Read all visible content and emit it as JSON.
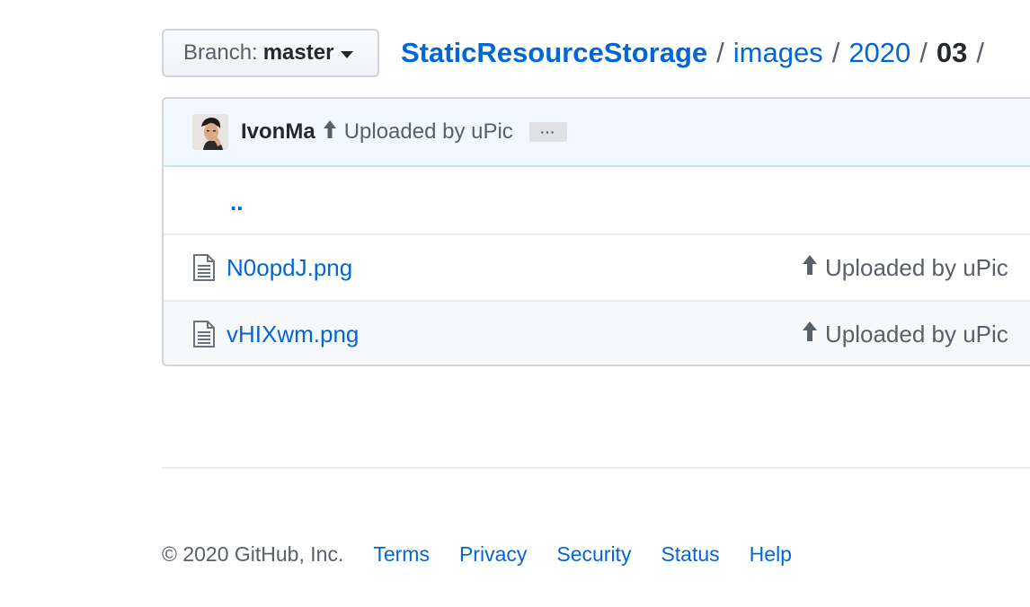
{
  "branch": {
    "label": "Branch:",
    "value": "master"
  },
  "breadcrumb": {
    "repo": "StaticResourceStorage",
    "segments": [
      "images",
      "2020"
    ],
    "current": "03",
    "separator": "/"
  },
  "commit": {
    "author": "IvonMa",
    "message": "Uploaded by uPic",
    "more": "···"
  },
  "files": {
    "parent": "..",
    "items": [
      {
        "name": "N0opdJ.png",
        "message": "Uploaded by uPic"
      },
      {
        "name": "vHIXwm.png",
        "message": "Uploaded by uPic"
      }
    ]
  },
  "footer": {
    "copyright": "© 2020 GitHub, Inc.",
    "links": [
      "Terms",
      "Privacy",
      "Security",
      "Status",
      "Help"
    ]
  },
  "colors": {
    "link": "#0366d6",
    "commit_bar": "#f1f8ff",
    "text_muted": "#586069"
  }
}
